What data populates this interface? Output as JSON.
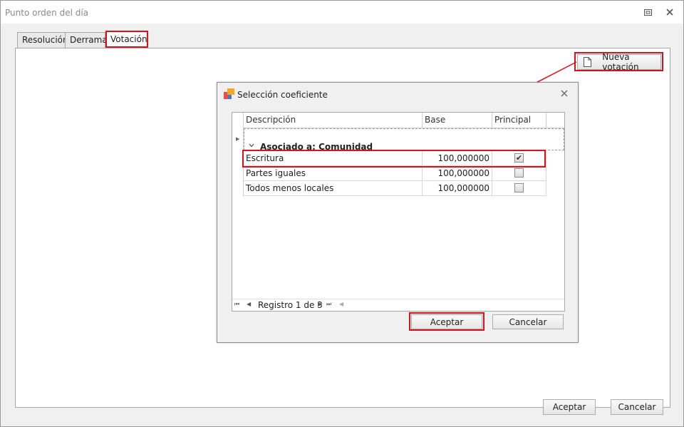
{
  "window": {
    "title": "Punto orden del día",
    "restore_icon": "restore-icon",
    "close_icon": "close-icon"
  },
  "tabs": [
    {
      "label": "Resolución",
      "active": false
    },
    {
      "label": "Derrama",
      "active": false
    },
    {
      "label": "Votación",
      "active": true
    }
  ],
  "toolbar": {
    "new_vote_label": "Nueva votación",
    "new_vote_icon": "document-icon"
  },
  "dialog": {
    "title": "Selección coeficiente",
    "app_icon": "app-logo-icon",
    "close_icon": "close-icon",
    "grid": {
      "columns": [
        "Descripción",
        "Base",
        "Principal"
      ],
      "group_label": "Asociado a: Comunidad",
      "rows": [
        {
          "descripcion": "Escritura",
          "base": "100,000000",
          "principal": true
        },
        {
          "descripcion": "Partes iguales",
          "base": "100,000000",
          "principal": false
        },
        {
          "descripcion": "Todos menos locales",
          "base": "100,000000",
          "principal": false
        }
      ],
      "navigator": {
        "text": "Registro 1 de 3"
      }
    },
    "accept_label": "Aceptar",
    "cancel_label": "Cancelar"
  },
  "footer": {
    "accept_label": "Aceptar",
    "cancel_label": "Cancelar"
  },
  "colors": {
    "highlight": "#d8111c",
    "arrow": "#d8111c"
  }
}
